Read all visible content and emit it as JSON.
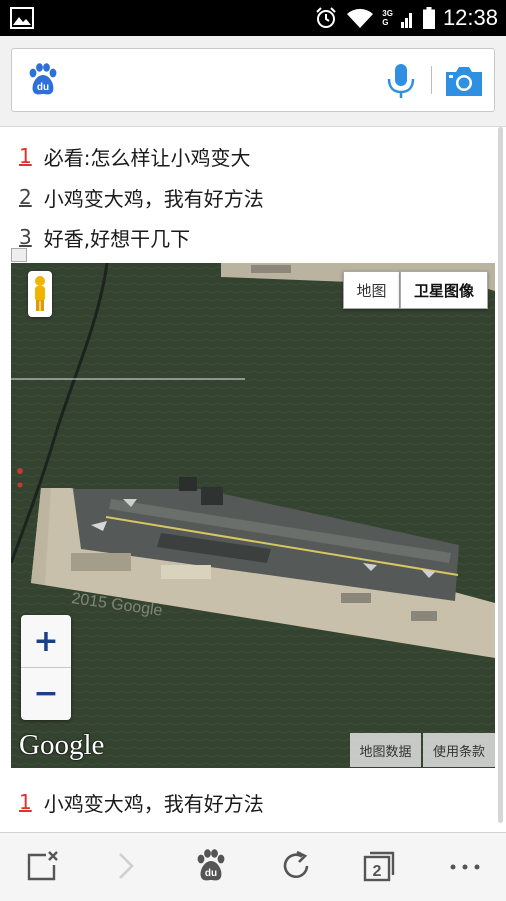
{
  "status_bar": {
    "time": "12:38",
    "net_top": "3G",
    "net_bottom": "G"
  },
  "search": {
    "value": "",
    "placeholder": ""
  },
  "list_top": [
    {
      "num": "1",
      "text": "必看:怎么样让小鸡变大"
    },
    {
      "num": "2",
      "text": "小鸡变大鸡，我有好方法"
    },
    {
      "num": "3",
      "text": "好香,好想干几下"
    }
  ],
  "map": {
    "type_map_label": "地图",
    "type_satellite_label": "卫星图像",
    "zoom_in": "+",
    "zoom_out": "−",
    "logo": "Google",
    "attribution_data": "地图数据",
    "attribution_terms": "使用条款",
    "watermark": "2015 Google"
  },
  "list_bottom": [
    {
      "num": "1",
      "text": "小鸡变大鸡，我有好方法"
    }
  ],
  "bottom_nav": {
    "tab_count": "2"
  },
  "colors": {
    "accent_red": "#e0322b",
    "baidu_blue": "#2f6fd9",
    "zoom_blue": "#1b3f89"
  }
}
